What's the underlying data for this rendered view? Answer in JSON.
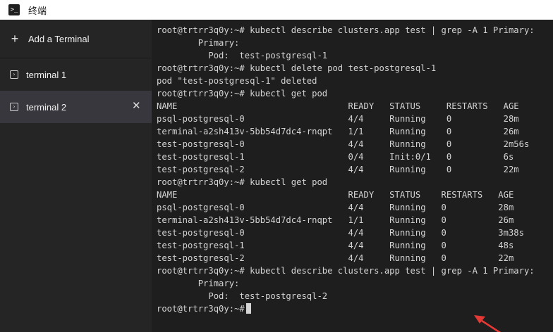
{
  "window": {
    "icon": ">_",
    "title": "终端"
  },
  "sidebar": {
    "add_label": "Add a Terminal",
    "items": [
      {
        "label": "terminal 1",
        "active": false
      },
      {
        "label": "terminal 2",
        "active": true
      }
    ]
  },
  "terminal": {
    "lines": [
      "root@trtrr3q0y:~# kubectl describe clusters.app test | grep -A 1 Primary:",
      "        Primary:",
      "          Pod:  test-postgresql-1",
      "root@trtrr3q0y:~# kubectl delete pod test-postgresql-1",
      "pod \"test-postgresql-1\" deleted",
      "root@trtrr3q0y:~# kubectl get pod",
      "NAME                                 READY   STATUS     RESTARTS   AGE",
      "psql-postgresql-0                    4/4     Running    0          28m",
      "terminal-a2sh413v-5bb54d7dc4-rnqpt   1/1     Running    0          26m",
      "test-postgresql-0                    4/4     Running    0          2m56s",
      "test-postgresql-1                    0/4     Init:0/1   0          6s",
      "test-postgresql-2                    4/4     Running    0          22m",
      "root@trtrr3q0y:~# kubectl get pod",
      "NAME                                 READY   STATUS    RESTARTS   AGE",
      "psql-postgresql-0                    4/4     Running   0          28m",
      "terminal-a2sh413v-5bb54d7dc4-rnqpt   1/1     Running   0          26m",
      "test-postgresql-0                    4/4     Running   0          3m38s",
      "test-postgresql-1                    4/4     Running   0          48s",
      "test-postgresql-2                    4/4     Running   0          22m",
      "root@trtrr3q0y:~# kubectl describe clusters.app test | grep -A 1 Primary:",
      "        Primary:",
      "          Pod:  test-postgresql-2"
    ],
    "prompt": "root@trtrr3q0y:~# "
  },
  "annotation": {
    "arrow_color": "#e53935"
  }
}
